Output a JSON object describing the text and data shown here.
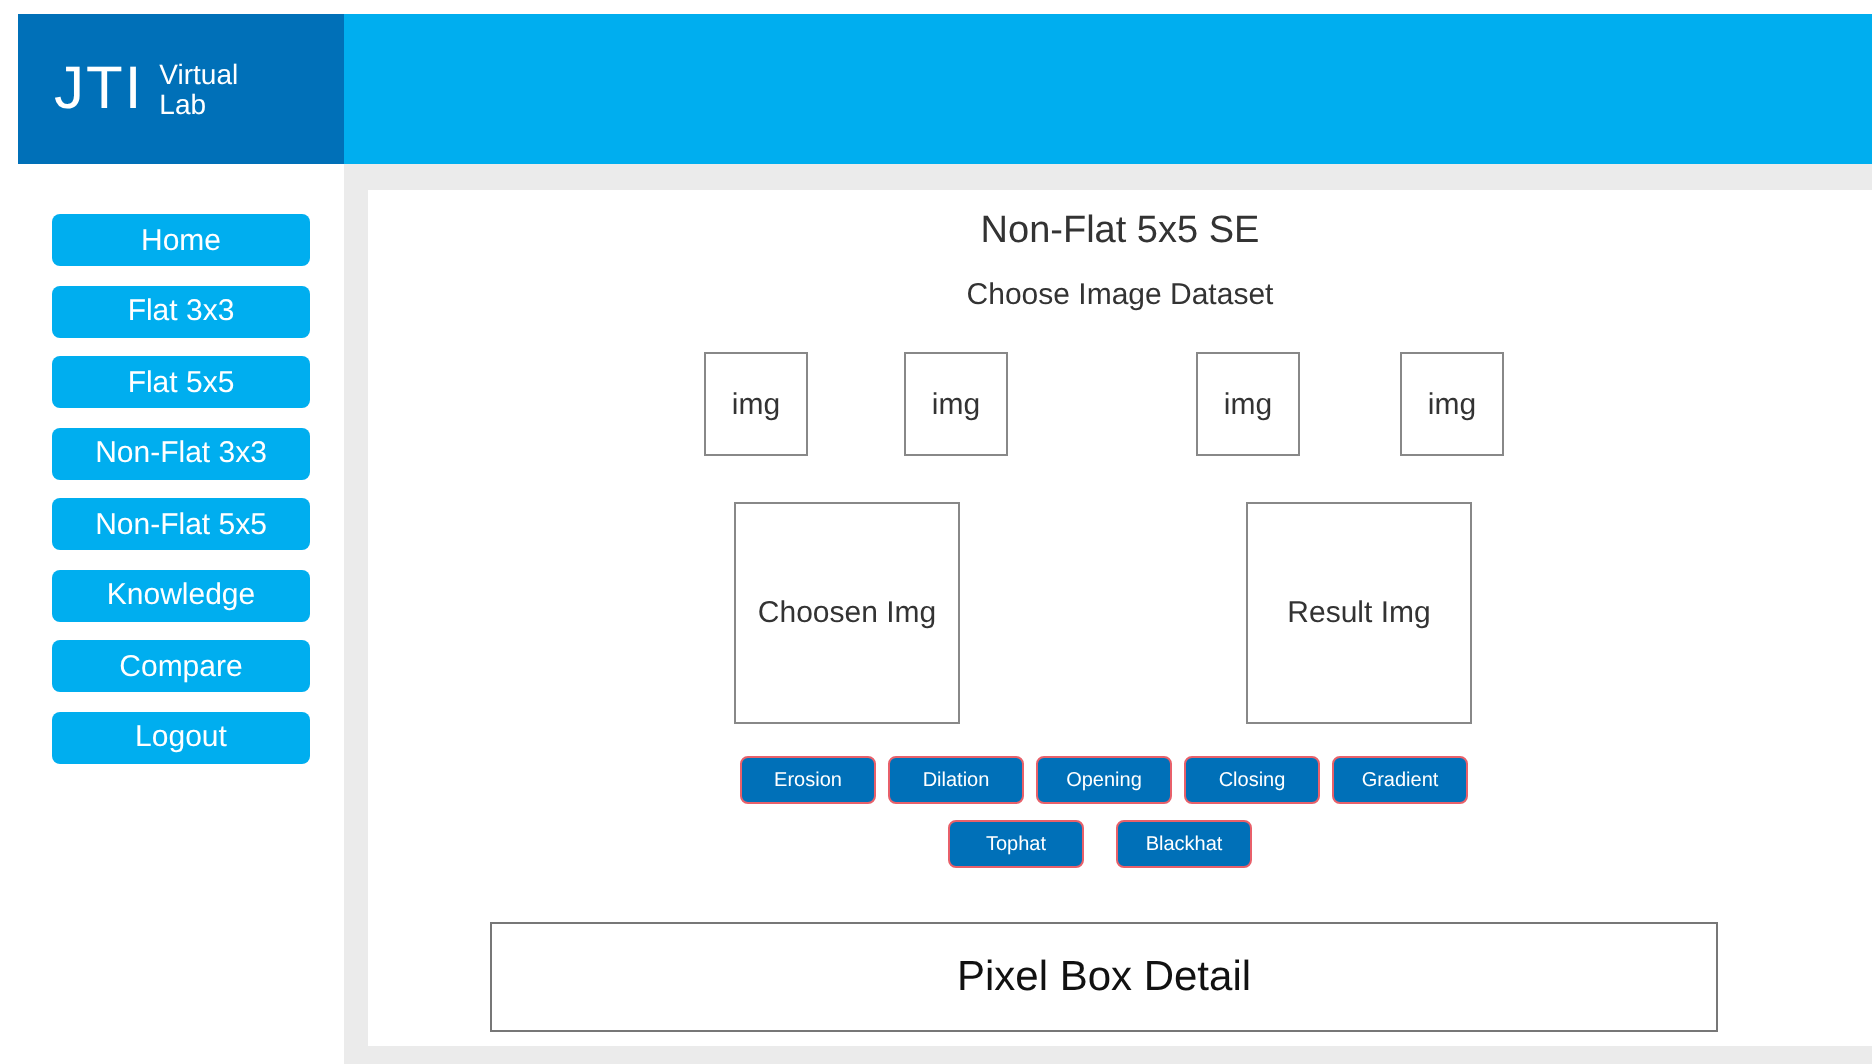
{
  "logo": {
    "mark": "JTI",
    "text_line1": "Virtual",
    "text_line2": "Lab"
  },
  "sidebar": {
    "items": [
      "Home",
      "Flat 3x3",
      "Flat 5x5",
      "Non-Flat 3x3",
      "Non-Flat 5x5",
      "Knowledge",
      "Compare",
      "Logout"
    ]
  },
  "main": {
    "title": "Non-Flat 5x5 SE",
    "subtitle": "Choose Image Dataset",
    "dataset_images": [
      "img",
      "img",
      "img",
      "img"
    ],
    "chosen_image": "Choosen Img",
    "result_image": "Result Img",
    "operation_rows": [
      [
        "Erosion",
        "Dilation",
        "Opening",
        "Closing",
        "Gradient"
      ],
      [
        "Tophat",
        "Blackhat"
      ]
    ],
    "pixel_box": "Pixel Box Detail"
  }
}
